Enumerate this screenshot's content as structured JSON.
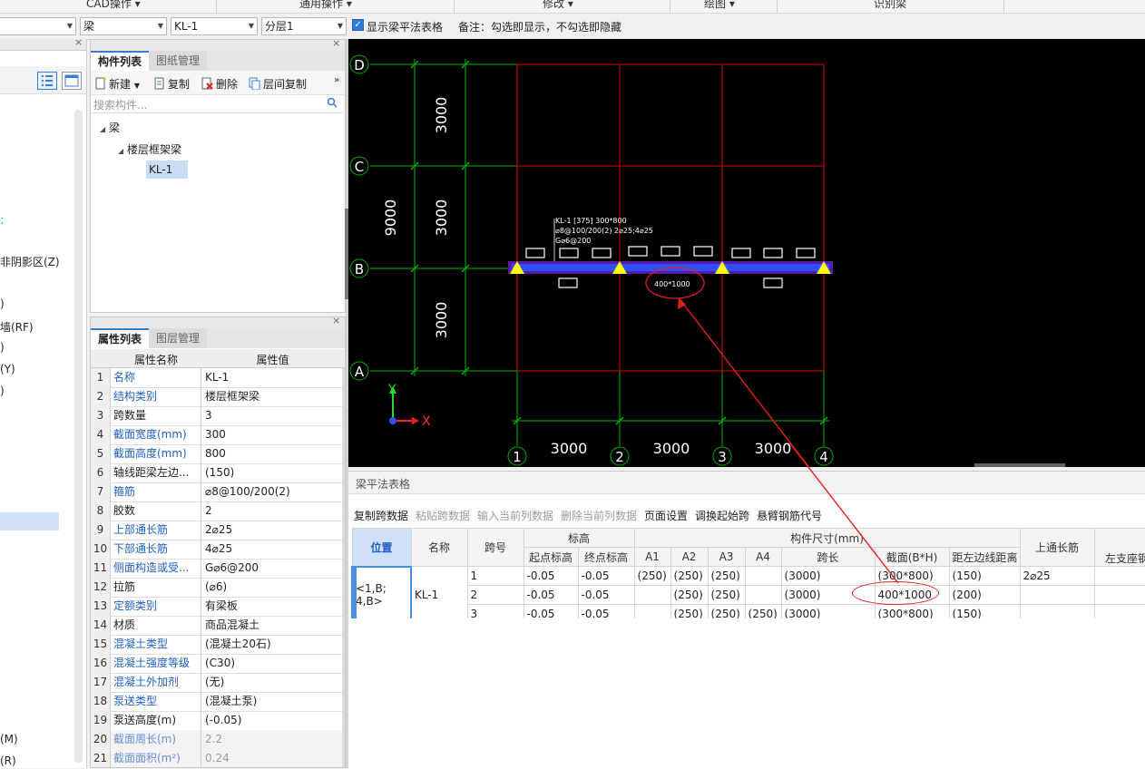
{
  "menubar": {
    "items": [
      "CAD操作",
      "通用操作",
      "修改",
      "绘图",
      "识别梁"
    ]
  },
  "toolbar": {
    "combo_first": "",
    "combo_type": "梁",
    "combo_component": "KL-1",
    "combo_layer": "分层1",
    "show_table_label": "显示梁平法表格",
    "note": "备注：勾选即显示，不勾选即隐藏"
  },
  "left_panel": {
    "text_items": [
      "非阴影区(Z)",
      ")",
      "墙(RF)",
      ")",
      "(Y)",
      ")",
      "(M)",
      "(R)"
    ]
  },
  "component_panel": {
    "tabs": [
      "构件列表",
      "图纸管理"
    ],
    "actions": {
      "new": "新建",
      "copy": "复制",
      "delete": "删除",
      "floor_copy": "层间复制"
    },
    "search_placeholder": "搜索构件...",
    "tree": {
      "root": "梁",
      "child": "楼层框架梁",
      "leaf": "KL-1"
    }
  },
  "property_panel": {
    "tabs": [
      "属性列表",
      "图层管理"
    ],
    "col_name": "属性名称",
    "col_value": "属性值",
    "rows": [
      {
        "n": "1",
        "k": "名称",
        "v": "KL-1"
      },
      {
        "n": "2",
        "k": "结构类别",
        "v": "楼层框架梁"
      },
      {
        "n": "3",
        "k": "跨数量",
        "v": "3"
      },
      {
        "n": "4",
        "k": "截面宽度(mm)",
        "v": "300"
      },
      {
        "n": "5",
        "k": "截面高度(mm)",
        "v": "800"
      },
      {
        "n": "6",
        "k": "轴线距梁左边...",
        "v": "(150)"
      },
      {
        "n": "7",
        "k": "箍筋",
        "v": "⌀8@100/200(2)"
      },
      {
        "n": "8",
        "k": "胶数",
        "v": "2"
      },
      {
        "n": "9",
        "k": "上部通长筋",
        "v": "2⌀25"
      },
      {
        "n": "10",
        "k": "下部通长筋",
        "v": "4⌀25"
      },
      {
        "n": "11",
        "k": "侧面构造或受...",
        "v": "G⌀6@200"
      },
      {
        "n": "12",
        "k": "拉筋",
        "v": "(⌀6)"
      },
      {
        "n": "13",
        "k": "定额类别",
        "v": "有梁板"
      },
      {
        "n": "14",
        "k": "材质",
        "v": "商品混凝土"
      },
      {
        "n": "15",
        "k": "混凝土类型",
        "v": "(混凝土20石)"
      },
      {
        "n": "16",
        "k": "混凝土强度等级",
        "v": "(C30)"
      },
      {
        "n": "17",
        "k": "混凝土外加剂",
        "v": "(无)"
      },
      {
        "n": "18",
        "k": "泵送类型",
        "v": "(混凝土泵)"
      },
      {
        "n": "19",
        "k": "泵送高度(m)",
        "v": "(-0.05)"
      },
      {
        "n": "20",
        "k": "截面周长(m)",
        "v": "2.2"
      },
      {
        "n": "21",
        "k": "截面面积(m²)",
        "v": "0.24"
      }
    ]
  },
  "cad": {
    "axes_letters": [
      "D",
      "C",
      "B",
      "A"
    ],
    "axes_numbers": [
      "1",
      "2",
      "3",
      "4"
    ],
    "dims_vertical": [
      "3000",
      "3000",
      "3000"
    ],
    "dim_total": "9000",
    "dims_horizontal": [
      "3000",
      "3000",
      "3000"
    ],
    "beam_label_lines": [
      "KL-1 [375] 300*800",
      "⌀8@100/200(2) 2⌀25;4⌀25",
      "G⌀6@200"
    ],
    "section_mark": "400*1000",
    "axis_y": "Y",
    "axis_x": "X",
    "colors": {
      "bg": "#000000",
      "grid_red": "#ff0000",
      "grid_green": "#00c000",
      "beam": "#3050ff",
      "support": "#ffff00",
      "arrow": "#e02020"
    }
  },
  "beam_table": {
    "title": "梁平法表格",
    "actions": [
      "复制跨数据",
      "粘贴跨数据",
      "输入当前列数据",
      "删除当前列数据",
      "页面设置",
      "调换起始跨",
      "悬臂钢筋代号"
    ],
    "headers": {
      "position": "位置",
      "name": "名称",
      "span": "跨号",
      "elev": "标高",
      "start_elev": "起点标高",
      "end_elev": "终点标高",
      "dims": "构件尺寸(mm)",
      "a1": "A1",
      "a2": "A2",
      "a3": "A3",
      "a4": "A4",
      "span_len": "跨长",
      "section": "截面(B*H)",
      "edge_dist": "距左边线距离",
      "top_bar": "上通长筋",
      "left_bar": "左支座钢"
    },
    "position_value": "<1,B;\n4,B>",
    "name_value": "KL-1",
    "rows": [
      {
        "span": "1",
        "start": "-0.05",
        "end": "-0.05",
        "a1": "(250)",
        "a2": "(250)",
        "a3": "(250)",
        "a4": "",
        "len": "(3000)",
        "section": "(300*800)",
        "edge": "(150)",
        "top": "2⌀25"
      },
      {
        "span": "2",
        "start": "-0.05",
        "end": "-0.05",
        "a1": "",
        "a2": "(250)",
        "a3": "(250)",
        "a4": "",
        "len": "(3000)",
        "section": "400*1000",
        "edge": "(200)",
        "top": ""
      },
      {
        "span": "3",
        "start": "-0.05",
        "end": "-0.05",
        "a1": "",
        "a2": "(250)",
        "a3": "(250)",
        "a4": "(250)",
        "len": "(3000)",
        "section": "(300*800)",
        "edge": "(150)",
        "top": ""
      }
    ]
  }
}
